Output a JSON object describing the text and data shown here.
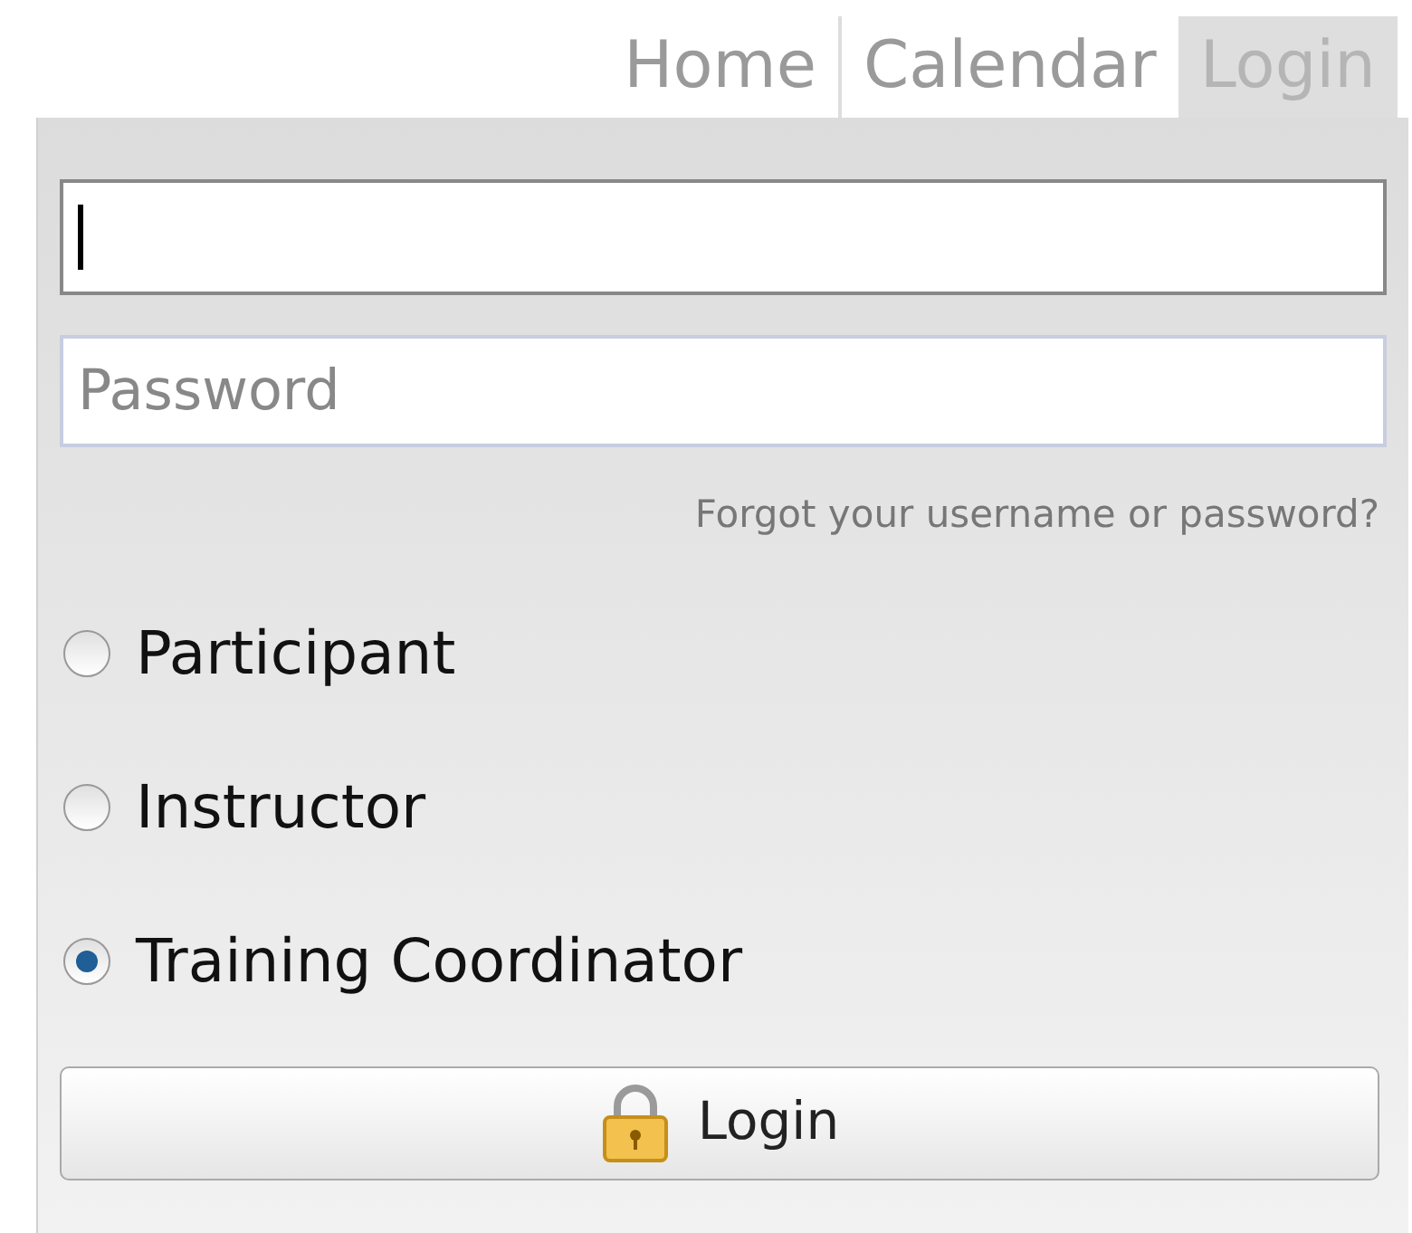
{
  "nav": {
    "tabs": [
      {
        "label": "Home",
        "selected": false
      },
      {
        "label": "Calendar",
        "selected": false
      },
      {
        "label": "Login",
        "selected": true
      }
    ]
  },
  "login": {
    "fields": [
      {
        "focused": true
      },
      {
        "placeholder": "Password",
        "focused": false
      }
    ],
    "forgot_link": "Forgot your username or password?",
    "roles": [
      {
        "label": "Participant",
        "selected": false
      },
      {
        "label": "Instructor",
        "selected": false
      },
      {
        "label": "Training Coordinator",
        "selected": true
      }
    ],
    "button": "Login"
  }
}
